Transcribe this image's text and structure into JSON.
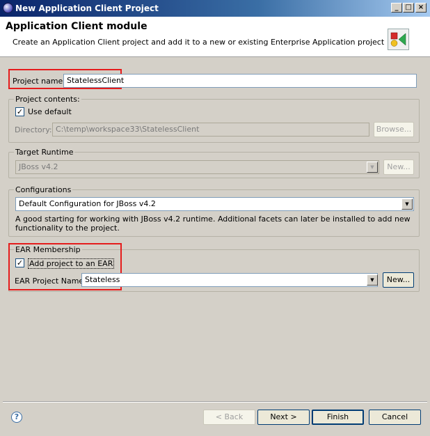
{
  "window": {
    "title": "New Application Client Project",
    "minimize": "_",
    "maximize": "□",
    "close": "×"
  },
  "header": {
    "title": "Application Client module",
    "description": "Create an Application Client project and add it to a new or existing Enterprise Application project"
  },
  "project_name": {
    "label": "Project name:",
    "value": "StatelessClient"
  },
  "project_contents": {
    "label": "Project contents:",
    "use_default_label": "Use default",
    "use_default_checked": true,
    "directory_label": "Directory:",
    "directory_value": "C:\\temp\\workspace33\\StatelessClient",
    "browse_label": "Browse..."
  },
  "target_runtime": {
    "label": "Target Runtime",
    "value": "JBoss v4.2",
    "new_label": "New..."
  },
  "configurations": {
    "label": "Configurations",
    "value": "Default Configuration for JBoss v4.2",
    "description": "A good starting for working with JBoss v4.2 runtime. Additional facets can later be installed to add new functionality to the project."
  },
  "ear_membership": {
    "label": "EAR Membership",
    "add_label": "Add project to an EAR",
    "add_checked": true,
    "project_name_label": "EAR Project Name:",
    "project_name_value": "Stateless",
    "new_label": "New..."
  },
  "footer": {
    "help": "?",
    "back_label": "< Back",
    "next_label": "Next >",
    "finish_label": "Finish",
    "cancel_label": "Cancel"
  },
  "colors": {
    "highlight": "#e51c1c",
    "titlebar": "#0a246a"
  }
}
